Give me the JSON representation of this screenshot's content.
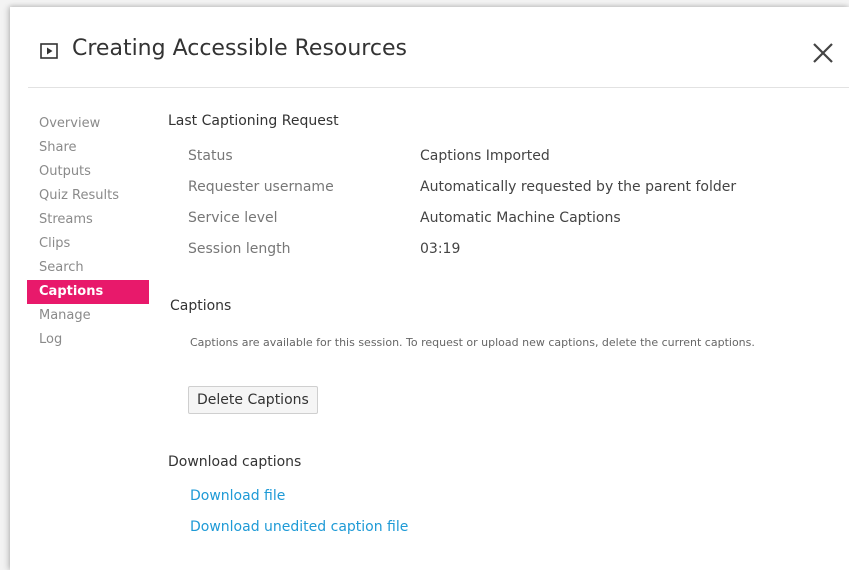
{
  "header": {
    "title": "Creating Accessible Resources"
  },
  "sidebar": {
    "items": [
      {
        "label": "Overview"
      },
      {
        "label": "Share"
      },
      {
        "label": "Outputs"
      },
      {
        "label": "Quiz Results"
      },
      {
        "label": "Streams"
      },
      {
        "label": "Clips"
      },
      {
        "label": "Search"
      },
      {
        "label": "Captions"
      },
      {
        "label": "Manage"
      },
      {
        "label": "Log"
      }
    ],
    "active": "Captions"
  },
  "last_request": {
    "title": "Last Captioning Request",
    "rows": [
      {
        "label": "Status",
        "value": "Captions Imported"
      },
      {
        "label": "Requester username",
        "value": "Automatically requested by the parent folder"
      },
      {
        "label": "Service level",
        "value": "Automatic Machine Captions"
      },
      {
        "label": "Session length",
        "value": "03:19"
      }
    ]
  },
  "captions": {
    "title": "Captions",
    "info": "Captions are available for this session. To request or upload new captions, delete the current captions.",
    "delete_label": "Delete Captions"
  },
  "download": {
    "title": "Download captions",
    "file_label": "Download file",
    "unedited_label": "Download unedited caption file"
  },
  "colors": {
    "accent": "#e8196b",
    "link": "#1e9ad6"
  },
  "icons": {
    "title_icon": "play-icon",
    "close": "close-icon"
  }
}
